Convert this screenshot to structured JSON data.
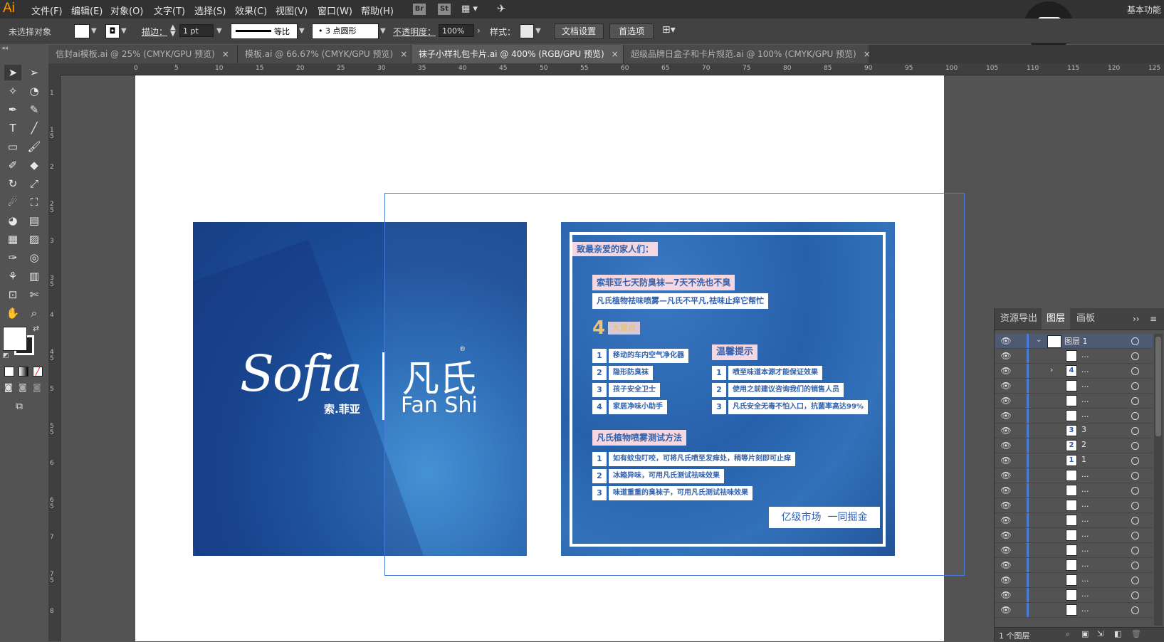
{
  "app": {
    "logo": "Ai",
    "workspace": "基本功能"
  },
  "menu": [
    "文件(F)",
    "编辑(E)",
    "对象(O)",
    "文字(T)",
    "选择(S)",
    "效果(C)",
    "视图(V)",
    "窗口(W)",
    "帮助(H)"
  ],
  "menu_icons": {
    "br": "Br",
    "st": "St"
  },
  "control": {
    "selection": "未选择对象",
    "stroke_label": "描边：",
    "stroke_value": "1 pt",
    "stroke_profile": "等比",
    "brush": "3 点圆形",
    "opacity_label": "不透明度：",
    "opacity_value": "100%",
    "style_label": "样式：",
    "doc_settings": "文档设置",
    "preferences": "首选项"
  },
  "tabs": [
    {
      "label": "信封ai模板.ai @ 25% (CMYK/GPU 预览)",
      "close": "×"
    },
    {
      "label": "模板.ai @ 66.67% (CMYK/GPU 预览)",
      "close": "×"
    },
    {
      "label": "袜子小样礼包卡片.ai @ 400% (RGB/GPU 预览)",
      "close": "×"
    },
    {
      "label": "超级品牌日盒子和卡片规范.ai @ 100% (CMYK/GPU 预览)",
      "close": "×"
    }
  ],
  "ruler_h": [
    "0",
    "5",
    "10",
    "15",
    "20",
    "25",
    "30",
    "35",
    "40",
    "45",
    "50",
    "55",
    "60",
    "65",
    "70",
    "75",
    "80",
    "85",
    "90",
    "95",
    "100",
    "105",
    "110",
    "115",
    "120",
    "125"
  ],
  "ruler_v": [
    "1",
    "1 5",
    "2",
    "2 5",
    "3",
    "3 5",
    "4",
    "4 5",
    "5",
    "5 5",
    "6",
    "6 5",
    "7",
    "7 5",
    "8"
  ],
  "card_front": {
    "script_logo": "Sofia",
    "cn_name": "索.菲亚",
    "brand_cn": "凡氏",
    "registered": "®",
    "brand_en": "Fan Shi"
  },
  "card_back": {
    "greeting": "致最亲爱的家人们：",
    "headline1": "索菲亚七天防臭袜—7天不洗也不臭",
    "headline2": "凡氏植物祛味喷雾—凡氏不平凡,祛味止痒它帮忙",
    "selling_badge": "4",
    "selling_title": "大賣点",
    "selling_points": [
      {
        "n": "1",
        "text": "移动的车内空气净化器"
      },
      {
        "n": "2",
        "text": "隐形防臭袜"
      },
      {
        "n": "3",
        "text": "孩子安全卫士"
      },
      {
        "n": "4",
        "text": "家居净味小助手"
      }
    ],
    "tips_title": "温馨提示",
    "tips": [
      {
        "n": "1",
        "text": "喷至味道本源才能保证效果"
      },
      {
        "n": "2",
        "text": "使用之前建议咨询我们的销售人员"
      },
      {
        "n": "3",
        "text": "凡氏安全无毒不怕入口，抗菌率高达99%"
      }
    ],
    "method_title": "凡氏植物喷雾测试方法",
    "methods": [
      {
        "n": "1",
        "text": "如有蚊虫叮咬，可将凡氏喷至发痒处，稍等片刻即可止痒"
      },
      {
        "n": "2",
        "text": "冰箱异味，可用凡氏测试祛味效果"
      },
      {
        "n": "3",
        "text": "味道重重的臭袜子，可用凡氏测试祛味效果"
      }
    ],
    "slogan": "亿级市场  一同掘金"
  },
  "layers_panel": {
    "tabs": [
      "资源导出",
      "图层",
      "画板"
    ],
    "active_tab": "图层",
    "layer_name": "图层 1",
    "rows": [
      {
        "thumb": "",
        "name": "..."
      },
      {
        "thumb": "4",
        "name": "..."
      },
      {
        "thumb": "",
        "name": "..."
      },
      {
        "thumb": "",
        "name": "..."
      },
      {
        "thumb": "",
        "name": "..."
      },
      {
        "thumb": "3",
        "name": "3"
      },
      {
        "thumb": "2",
        "name": "2"
      },
      {
        "thumb": "1",
        "name": "1"
      },
      {
        "thumb": "",
        "name": "..."
      },
      {
        "thumb": "",
        "name": "..."
      },
      {
        "thumb": "",
        "name": "..."
      },
      {
        "thumb": "",
        "name": "..."
      },
      {
        "thumb": "",
        "name": "..."
      },
      {
        "thumb": "",
        "name": "..."
      },
      {
        "thumb": "",
        "name": "..."
      },
      {
        "thumb": "",
        "name": "..."
      },
      {
        "thumb": "",
        "name": "..."
      },
      {
        "thumb": "",
        "name": "..."
      }
    ],
    "footer": "1 个图层"
  },
  "colors": {
    "accent_blue": "#2a5cab",
    "selection_blue": "#4a7bd9",
    "logo_orange": "#ff9a00"
  }
}
